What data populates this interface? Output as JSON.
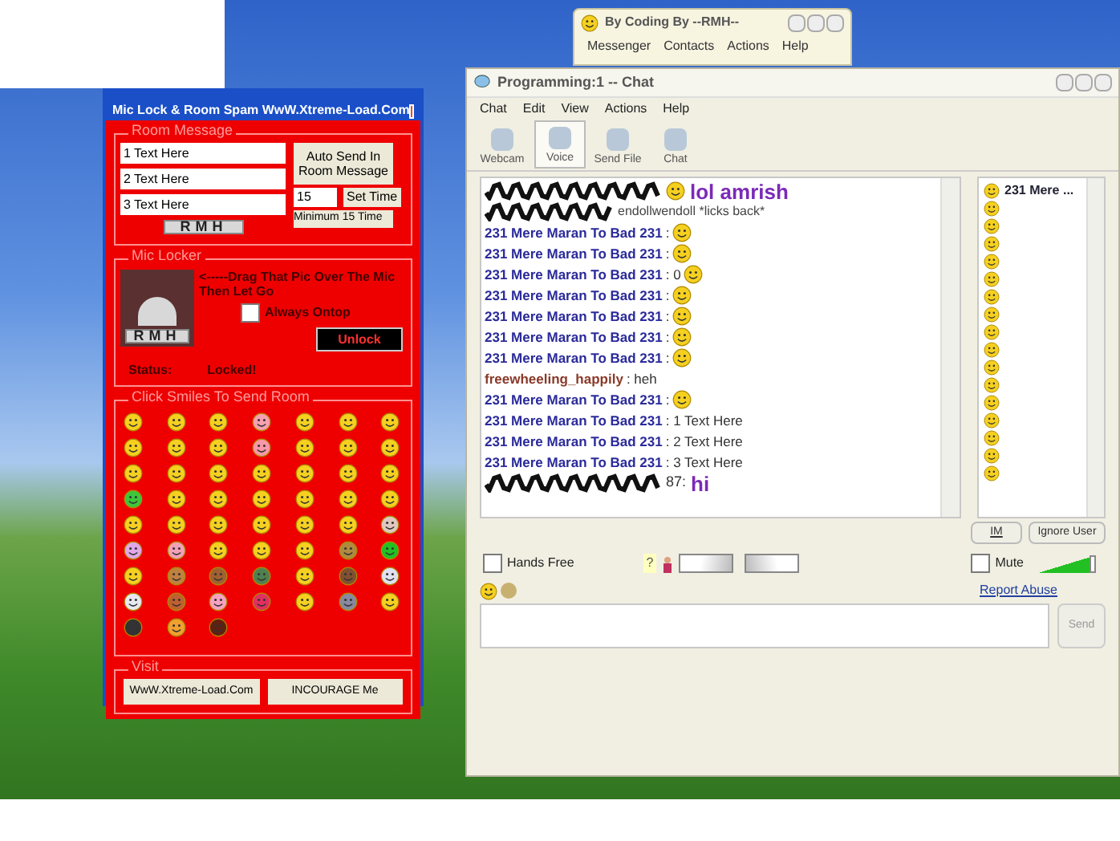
{
  "messenger_window": {
    "title": "By Coding By --RMH--",
    "menu": [
      "Messenger",
      "Contacts",
      "Actions",
      "Help"
    ]
  },
  "tool_window": {
    "title": "Mic Lock & Room Spam WwW.Xtreme-Load.Com",
    "room_message": {
      "legend": "Room Message",
      "fields": [
        "1 Text Here",
        "2 Text Here",
        "3 Text Here"
      ],
      "auto_send_button": "Auto Send In Room Message",
      "interval": "15",
      "set_time_button": "Set Time",
      "minimum_note": "Minimum 15 Time",
      "logo": "RMH"
    },
    "mic_locker": {
      "legend": "Mic Locker",
      "logo": "RMH",
      "instruction": "<-----Drag That Pic Over The Mic Then Let Go",
      "always_ontop": {
        "label": "Always Ontop",
        "checked": false
      },
      "unlock_button": "Unlock",
      "status_label": "Status:",
      "status_value": "Locked!"
    },
    "smileys": {
      "legend": "Click Smiles To Send Room"
    },
    "visit": {
      "legend": "Visit",
      "buttons": [
        "WwW.Xtreme-Load.Com",
        "INCOURAGE Me"
      ]
    }
  },
  "chat_window": {
    "title": "Programming:1 -- Chat",
    "menu": [
      "Chat",
      "Edit",
      "View",
      "Actions",
      "Help"
    ],
    "toolbar": [
      {
        "label": "Webcam",
        "selected": false
      },
      {
        "label": "Voice",
        "selected": true
      },
      {
        "label": "Send File",
        "selected": false
      },
      {
        "label": "Chat",
        "selected": false
      }
    ],
    "messages": [
      {
        "kind": "redacted",
        "text": "lol amrish",
        "big": true,
        "smiley": true
      },
      {
        "kind": "redacted",
        "text": "endollwendoll *licks back*",
        "big": false,
        "smiley": false
      },
      {
        "kind": "user",
        "sender": "231 Mere Maran To Bad 231",
        "text": ":",
        "smiley": true,
        "color": "#2b2b9b"
      },
      {
        "kind": "user",
        "sender": "231 Mere Maran To Bad 231",
        "text": ":",
        "smiley": true,
        "color": "#2b2b9b"
      },
      {
        "kind": "user",
        "sender": "231 Mere Maran To Bad 231",
        "text": ": 0",
        "smiley": true,
        "color": "#2b2b9b"
      },
      {
        "kind": "user",
        "sender": "231 Mere Maran To Bad 231",
        "text": ":",
        "smiley": true,
        "color": "#2b2b9b"
      },
      {
        "kind": "user",
        "sender": "231 Mere Maran To Bad 231",
        "text": ":",
        "smiley": true,
        "color": "#2b2b9b"
      },
      {
        "kind": "user",
        "sender": "231 Mere Maran To Bad 231",
        "text": ":",
        "smiley": true,
        "color": "#2b2b9b"
      },
      {
        "kind": "user",
        "sender": "231 Mere Maran To Bad 231",
        "text": ":",
        "smiley": true,
        "color": "#2b2b9b"
      },
      {
        "kind": "user",
        "sender": "freewheeling_happily",
        "text": ": heh",
        "smiley": false,
        "color": "#8a3a2a"
      },
      {
        "kind": "user",
        "sender": "231 Mere Maran To Bad 231",
        "text": ":",
        "smiley": true,
        "color": "#2b2b9b"
      },
      {
        "kind": "user",
        "sender": "231 Mere Maran To Bad 231",
        "text": ": 1 Text Here",
        "smiley": false,
        "color": "#2b2b9b"
      },
      {
        "kind": "user",
        "sender": "231 Mere Maran To Bad 231",
        "text": ": 2 Text Here",
        "smiley": false,
        "color": "#2b2b9b"
      },
      {
        "kind": "user",
        "sender": "231 Mere Maran To Bad 231",
        "text": ": 3 Text Here",
        "smiley": false,
        "color": "#2b2b9b"
      },
      {
        "kind": "redacted",
        "sender": "87:",
        "text": "hi",
        "big": true,
        "smiley": false
      }
    ],
    "user_list": {
      "first_user": "231 Mere ..."
    },
    "im_button": "IM",
    "ignore_button": "Ignore User",
    "hands_free": {
      "label": "Hands Free",
      "checked": false
    },
    "voice_help": "?",
    "mute": {
      "label": "Mute",
      "checked": false
    },
    "volume": {
      "level": 0.9
    },
    "report_abuse": "Report Abuse",
    "send_button": {
      "label": "Send",
      "disabled": true
    }
  }
}
